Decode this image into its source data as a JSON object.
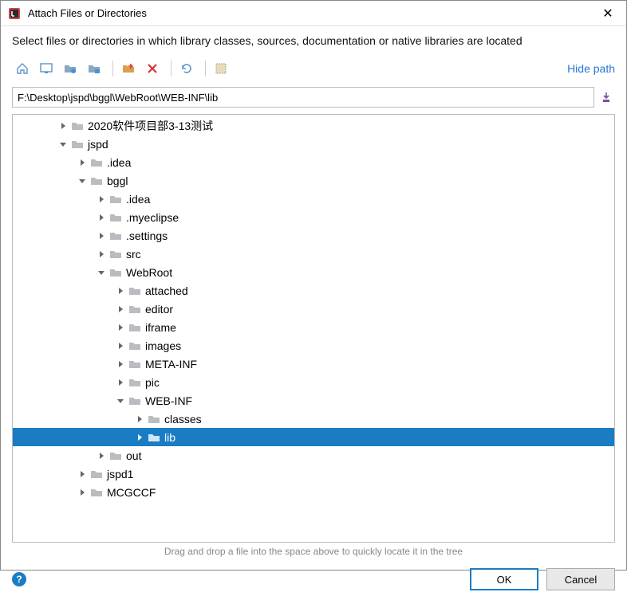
{
  "titlebar": {
    "title": "Attach Files or Directories",
    "close": "✕"
  },
  "instruction": "Select files or directories in which library classes, sources, documentation or native libraries are located",
  "toolbar": {
    "hide_path": "Hide path"
  },
  "path": {
    "value": "F:\\Desktop\\jspd\\bggl\\WebRoot\\WEB-INF\\lib"
  },
  "tree": {
    "rows": [
      {
        "indent": 2,
        "chev": "right",
        "label": "2020软件项目部3-13测试"
      },
      {
        "indent": 2,
        "chev": "down",
        "label": "jspd"
      },
      {
        "indent": 3,
        "chev": "right",
        "label": ".idea"
      },
      {
        "indent": 3,
        "chev": "down",
        "label": "bggl"
      },
      {
        "indent": 4,
        "chev": "right",
        "label": ".idea"
      },
      {
        "indent": 4,
        "chev": "right",
        "label": ".myeclipse"
      },
      {
        "indent": 4,
        "chev": "right",
        "label": ".settings"
      },
      {
        "indent": 4,
        "chev": "right",
        "label": "src"
      },
      {
        "indent": 4,
        "chev": "down",
        "label": "WebRoot"
      },
      {
        "indent": 5,
        "chev": "right",
        "label": "attached"
      },
      {
        "indent": 5,
        "chev": "right",
        "label": "editor"
      },
      {
        "indent": 5,
        "chev": "right",
        "label": "iframe"
      },
      {
        "indent": 5,
        "chev": "right",
        "label": "images"
      },
      {
        "indent": 5,
        "chev": "right",
        "label": "META-INF"
      },
      {
        "indent": 5,
        "chev": "right",
        "label": "pic"
      },
      {
        "indent": 5,
        "chev": "down",
        "label": "WEB-INF"
      },
      {
        "indent": 6,
        "chev": "right",
        "label": "classes"
      },
      {
        "indent": 6,
        "chev": "right",
        "label": "lib",
        "selected": true
      },
      {
        "indent": 4,
        "chev": "right",
        "label": "out"
      },
      {
        "indent": 3,
        "chev": "right",
        "label": "jspd1"
      },
      {
        "indent": 3,
        "chev": "right",
        "label": "MCGCCF"
      }
    ]
  },
  "hint": "Drag and drop a file into the space above to quickly locate it in the tree",
  "buttons": {
    "ok": "OK",
    "cancel": "Cancel"
  }
}
